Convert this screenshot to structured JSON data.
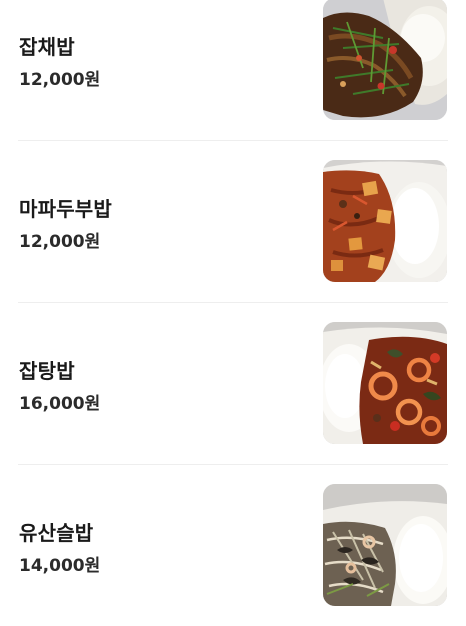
{
  "menu": {
    "items": [
      {
        "name": "잡채밥",
        "price": "12,000원",
        "image": "japchae-rice-photo"
      },
      {
        "name": "마파두부밥",
        "price": "12,000원",
        "image": "mapo-tofu-rice-photo"
      },
      {
        "name": "잡탕밥",
        "price": "16,000원",
        "image": "seafood-japtang-rice-photo"
      },
      {
        "name": "유산슬밥",
        "price": "14,000원",
        "image": "yusanseul-rice-photo"
      }
    ]
  }
}
